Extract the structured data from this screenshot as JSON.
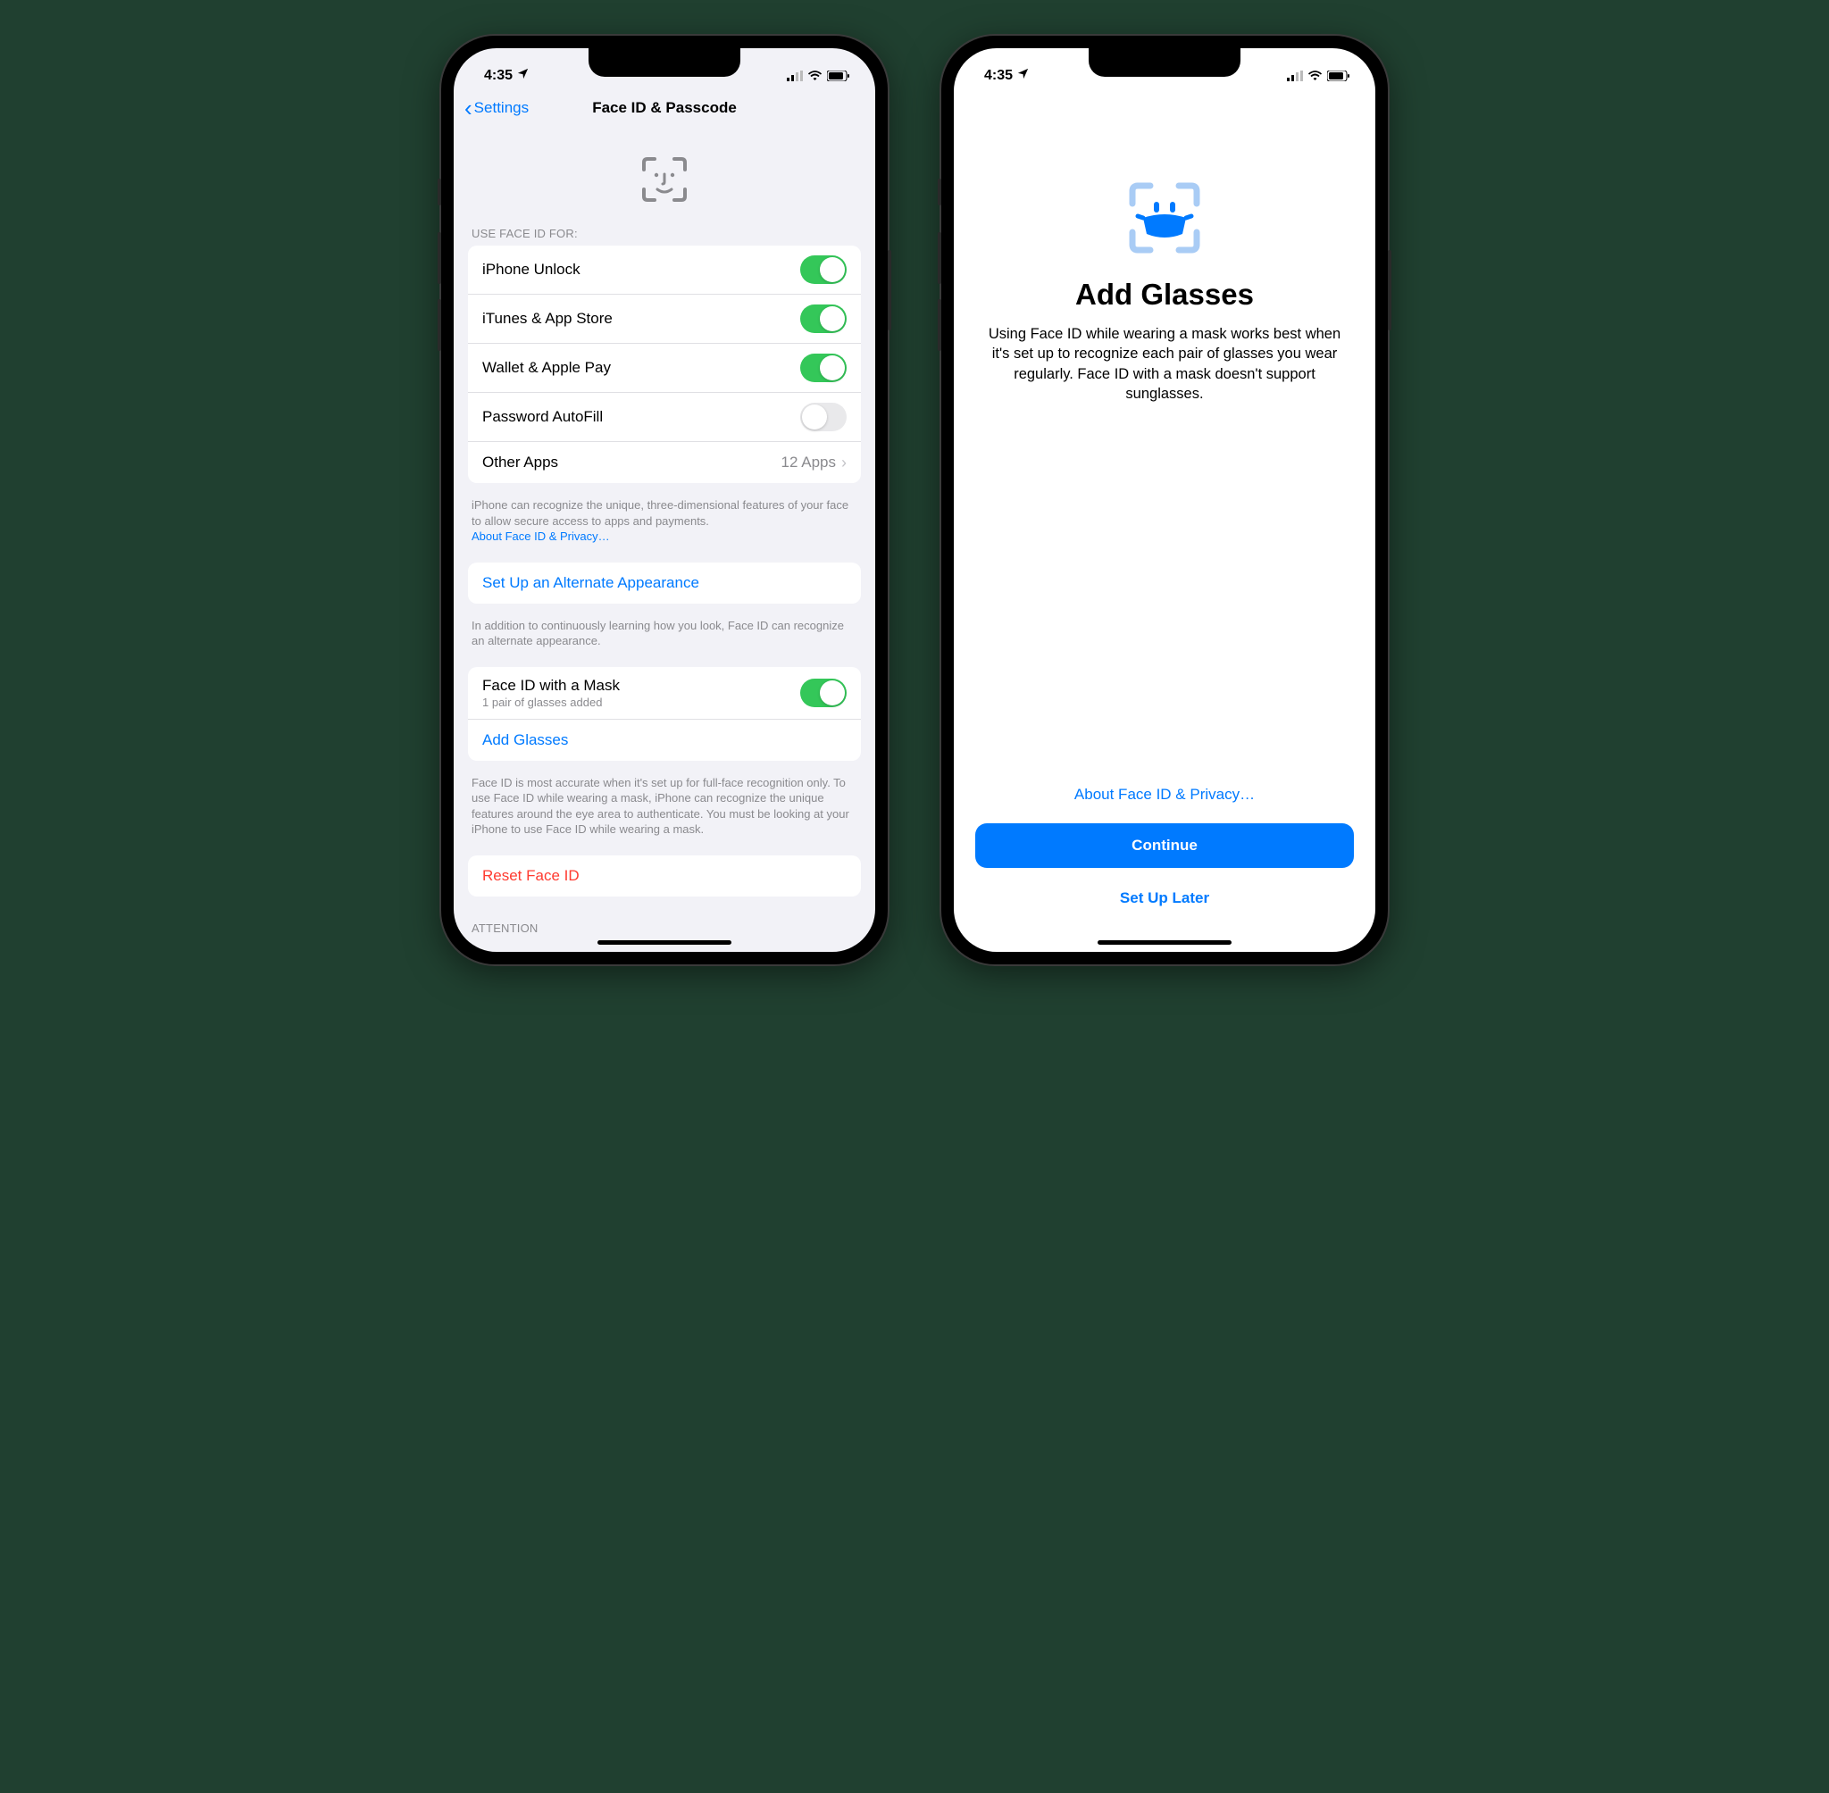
{
  "status": {
    "time": "4:35"
  },
  "left": {
    "nav": {
      "back": "Settings",
      "title": "Face ID & Passcode"
    },
    "section1_header": "USE FACE ID FOR:",
    "rows": {
      "iphone_unlock": {
        "label": "iPhone Unlock",
        "on": true
      },
      "itunes": {
        "label": "iTunes & App Store",
        "on": true
      },
      "wallet": {
        "label": "Wallet & Apple Pay",
        "on": true
      },
      "autofill": {
        "label": "Password AutoFill",
        "on": false
      },
      "other_apps": {
        "label": "Other Apps",
        "value": "12 Apps"
      }
    },
    "foot1": {
      "text": "iPhone can recognize the unique, three-dimensional features of your face to allow secure access to apps and payments.",
      "link": "About Face ID & Privacy…"
    },
    "alt_appearance": {
      "label": "Set Up an Alternate Appearance"
    },
    "foot2": "In addition to continuously learning how you look, Face ID can recognize an alternate appearance.",
    "mask": {
      "label": "Face ID with a Mask",
      "sub": "1 pair of glasses added",
      "on": true
    },
    "add_glasses": {
      "label": "Add Glasses"
    },
    "foot3": "Face ID is most accurate when it's set up for full-face recognition only. To use Face ID while wearing a mask, iPhone can recognize the unique features around the eye area to authenticate. You must be looking at your iPhone to use Face ID while wearing a mask.",
    "reset": {
      "label": "Reset Face ID"
    },
    "attention_header": "ATTENTION"
  },
  "right": {
    "title": "Add Glasses",
    "desc": "Using Face ID while wearing a mask works best when it's set up to recognize each pair of glasses you wear regularly. Face ID with a mask doesn't support sunglasses.",
    "about": "About Face ID & Privacy…",
    "continue": "Continue",
    "later": "Set Up Later"
  }
}
